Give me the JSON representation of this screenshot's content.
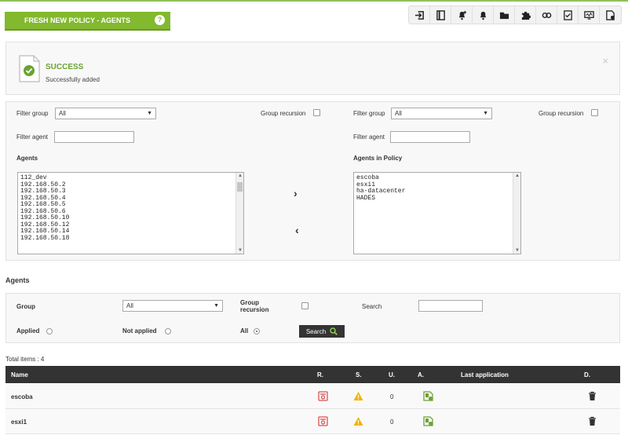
{
  "header": {
    "title": "FRESH NEW POLICY - AGENTS",
    "help_label": "?",
    "toolbar_icons": [
      "login-icon",
      "book-icon",
      "alert-bell-add-icon",
      "bell-icon",
      "folder-icon",
      "puzzle-icon",
      "link-icon",
      "checklist-icon",
      "monitor-icon",
      "policy-file-icon"
    ]
  },
  "notice": {
    "title": "SUCCESS",
    "message": "Successfully added",
    "close": "×"
  },
  "transfer": {
    "left": {
      "filter_group_label": "Filter group",
      "filter_group_value": "All",
      "group_recursion_label": "Group recursion",
      "filter_agent_label": "Filter agent",
      "filter_agent_value": "",
      "list_title": "Agents",
      "items": [
        "112_dev",
        "192.168.50.2",
        "192.168.50.3",
        "192.168.50.4",
        "192.168.50.5",
        "192.168.50.6",
        "192.168.50.10",
        "192.168.50.12",
        "192.168.50.14",
        "192.168.50.18"
      ]
    },
    "right": {
      "filter_group_label": "Filter group",
      "filter_group_value": "All",
      "group_recursion_label": "Group recursion",
      "filter_agent_label": "Filter agent",
      "filter_agent_value": "",
      "list_title": "Agents in Policy",
      "items": [
        "escoba",
        "esxi1",
        "ha-datacenter",
        "HADES"
      ]
    },
    "add_arrow": "›",
    "remove_arrow": "‹"
  },
  "agents_search": {
    "section_title": "Agents",
    "group_label": "Group",
    "group_value": "All",
    "group_recursion_label": "Group recursion",
    "search_label": "Search",
    "search_value": "",
    "applied_label": "Applied",
    "not_applied_label": "Not applied",
    "all_label": "All",
    "selected_filter": "All",
    "search_button": "Search"
  },
  "table": {
    "total_label": "Total items : 4",
    "columns": [
      "Name",
      "R.",
      "S.",
      "U.",
      "A.",
      "Last application",
      "D."
    ],
    "rows": [
      {
        "name": "escoba",
        "u": "0",
        "last_application": ""
      },
      {
        "name": "esxi1",
        "u": "0",
        "last_application": ""
      }
    ]
  },
  "colors": {
    "accent_green": "#82b92e",
    "success_green": "#6aa333",
    "warning_yellow": "#f0b400",
    "danger_red": "#d9534f",
    "table_header": "#333333"
  }
}
